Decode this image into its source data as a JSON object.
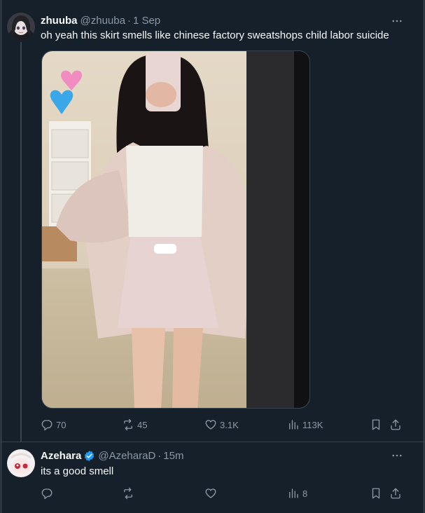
{
  "tweets": [
    {
      "author": {
        "name": "zhuuba",
        "handle": "@zhuuba",
        "verified": false
      },
      "separator": "·",
      "time": "1 Sep",
      "text": "oh yeah this skirt smells like chinese factory sweatshops child labor suicide",
      "media": {
        "type": "mirror-selfie-photo"
      },
      "stats": {
        "replies": "70",
        "retweets": "45",
        "likes": "3.1K",
        "views": "113K"
      }
    },
    {
      "author": {
        "name": "Azehara",
        "handle": "@AzeharaD",
        "verified": true
      },
      "separator": "·",
      "time": "15m",
      "text": "its a good smell",
      "stats": {
        "replies": "",
        "retweets": "",
        "likes": "",
        "views": "8"
      }
    }
  ],
  "colors": {
    "background": "#15202b",
    "border": "#38444d",
    "text_primary": "#f7f9f9",
    "text_secondary": "#8b98a5",
    "verified": "#1d9bf0"
  },
  "icons": [
    "reply-icon",
    "retweet-icon",
    "like-icon",
    "views-icon",
    "bookmark-icon",
    "share-icon",
    "more-icon",
    "verified-badge-icon"
  ]
}
